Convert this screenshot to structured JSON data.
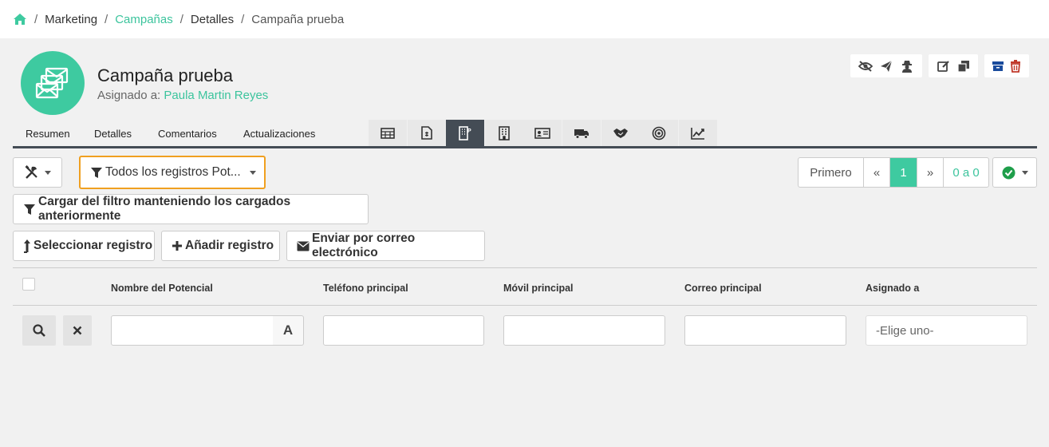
{
  "breadcrumb": {
    "items": [
      {
        "label": "Marketing"
      },
      {
        "label": "Campañas"
      },
      {
        "label": "Detalles"
      },
      {
        "label": "Campaña prueba"
      }
    ]
  },
  "record": {
    "title": "Campaña prueba",
    "assigned_label": "Asignado a:",
    "assigned_user": "Paula Martin Reyes"
  },
  "tabs": [
    "Resumen",
    "Detalles",
    "Comentarios",
    "Actualizaciones"
  ],
  "toolbar": {
    "filter_select": "Todos los registros Pot...",
    "load_filter": "Cargar del filtro manteniendo los cargados anteriormente",
    "select_record": "Seleccionar registro",
    "add_record": "Añadir registro",
    "send_email": "Enviar por correo electrónico"
  },
  "pagination": {
    "first": "Primero",
    "prev": "«",
    "current": "1",
    "next": "»",
    "count": "0 a 0"
  },
  "table": {
    "columns": [
      "Nombre del Potencial",
      "Teléfono principal",
      "Móvil principal",
      "Correo principal",
      "Asignado a"
    ],
    "text_filter_button": "A",
    "assigned_placeholder": "-Elige uno-"
  },
  "colors": {
    "accent": "#3ecaa0",
    "tab_bar": "#444c55",
    "filter_highlight": "#f0a020",
    "delete": "#c0392b",
    "archive": "#1a4b9c",
    "check": "#1e9e4a"
  }
}
